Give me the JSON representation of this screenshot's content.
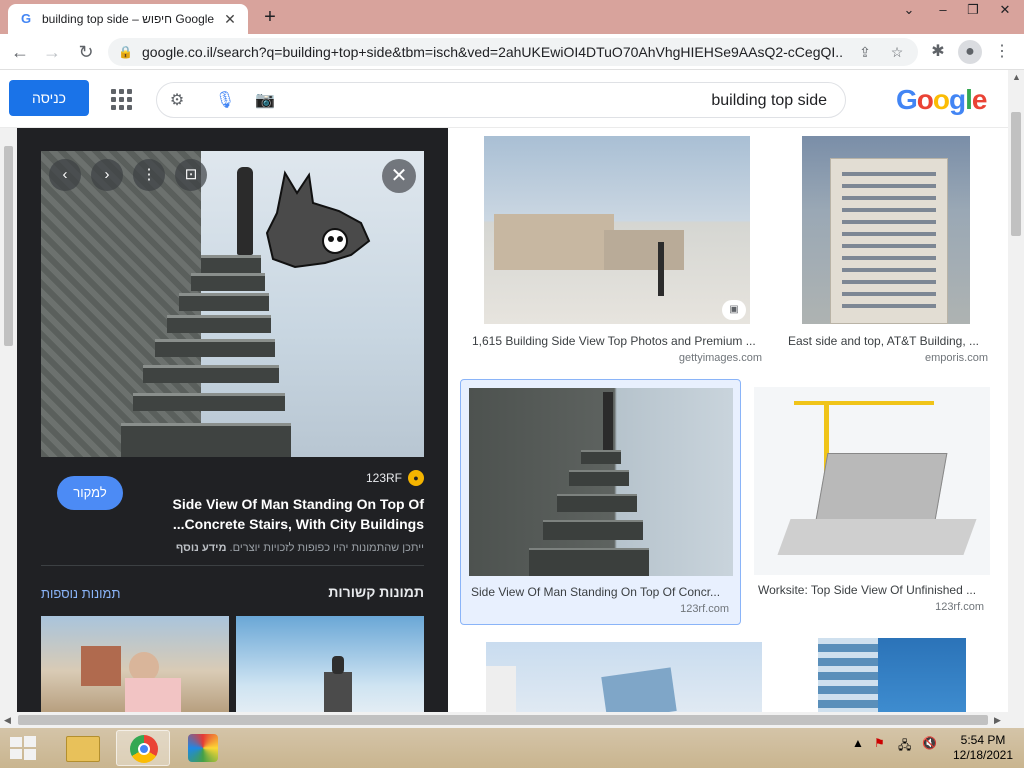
{
  "browser": {
    "tab_title": "building top side – חיפוש Google",
    "new_tab_symbol": "+",
    "url": "google.co.il/search?q=building+top+side&tbm=isch&ved=2ahUKEwiOI4DTuO70AhVhgHIEHSe9AAsQ2-cCegQI...",
    "window_controls": [
      "⌄",
      "–",
      "❐",
      "✕"
    ]
  },
  "header": {
    "signin_label": "כניסה",
    "search_query": "building top side",
    "logo_letters": [
      "G",
      "o",
      "o",
      "g",
      "l",
      "e"
    ]
  },
  "preview": {
    "source_name": "123RF",
    "visit_label": "למקור",
    "title": "Side View Of Man Standing On Top Of Concrete Stairs, With City Buildings...",
    "copyright_prefix": "ייתכן שהתמונות יהיו כפופות לזכויות יוצרים.",
    "learn_more": "מידע נוסף",
    "related_heading": "תמונות קשורות",
    "more_images": "תמונות נוספות"
  },
  "results": [
    {
      "title": "1,615 Building Side View Top Photos and Premium ...",
      "source": "gettyimages.com"
    },
    {
      "title": "East side and top, AT&T Building, ...",
      "source": "emporis.com"
    },
    {
      "title": "Side View Of Man Standing On Top Of Concr...",
      "source": "123rf.com"
    },
    {
      "title": "Worksite: Top Side View Of Unfinished ...",
      "source": "123rf.com"
    }
  ],
  "taskbar": {
    "time": "5:54 PM",
    "date": "12/18/2021"
  },
  "colors": {
    "tabstrip": "#d8a39c",
    "accent": "#1a73e8",
    "preview_bg": "#202124",
    "link": "#8ab4f8"
  }
}
